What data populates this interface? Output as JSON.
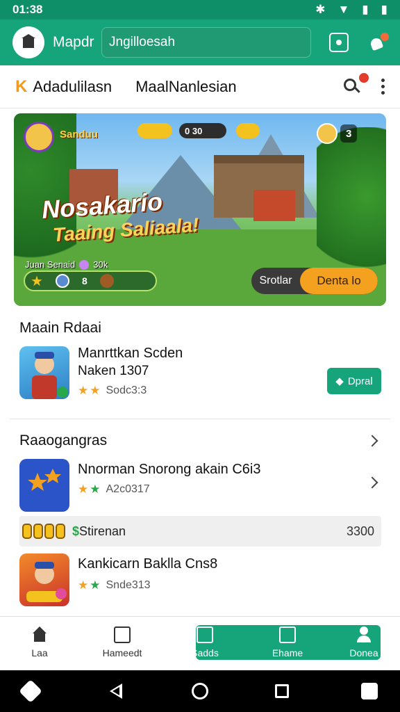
{
  "status_bar": {
    "time": "01:38"
  },
  "app_bar": {
    "title": "Mapdr",
    "search_value": "Jngilloesah"
  },
  "tabs": {
    "items": [
      "Adadulilasn",
      "MaalNanlesian"
    ]
  },
  "banner": {
    "hero_name": "Sanduu",
    "pill_a": "",
    "pill_b": "0 30",
    "score": "3",
    "title": "Nosakario",
    "subtitle": "Taaing Saliaala!",
    "stat_label": "Juan Senaid",
    "stat_value": "30k",
    "resource_value": "8",
    "cta_left": "Srotlar",
    "cta_right": "Denta lo"
  },
  "main_section": {
    "title": "Maain Rdaai",
    "item": {
      "name": "Manrttkan Scden",
      "sub": "Naken 1307",
      "rating_count": "Sodc3:3",
      "install_label": "Dpral"
    }
  },
  "recommended": {
    "title": "Raaogangras",
    "items": [
      {
        "name": "Nnorman Snorong akain C6i3",
        "rating_count": "A2c0317"
      },
      {
        "name": "Kankicarn Baklla Cns8",
        "rating_count": "Snde313"
      }
    ],
    "strip": {
      "label_prefix": "$",
      "label": "Stirenan",
      "value": "3300"
    }
  },
  "bottom_nav": {
    "items": [
      {
        "label": "Laa"
      },
      {
        "label": "Hameedt"
      },
      {
        "label": "Sadds"
      },
      {
        "label": "Ehame"
      },
      {
        "label": "Donea"
      }
    ]
  },
  "colors": {
    "accent": "#16a57a",
    "status": "#0e8f68",
    "cta": "#f3a11e"
  }
}
